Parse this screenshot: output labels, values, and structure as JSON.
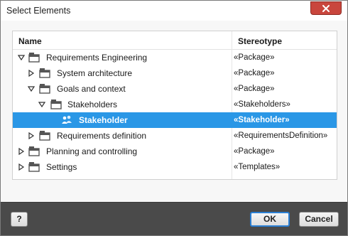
{
  "window": {
    "title": "Select Elements"
  },
  "table": {
    "columns": {
      "name": "Name",
      "stereotype": "Stereotype"
    },
    "rows": [
      {
        "label": "Requirements Engineering",
        "stereotype": "«Package»",
        "expanded": true,
        "icon": "package-icon",
        "selected": false
      },
      {
        "label": "System architecture",
        "stereotype": "«Package»",
        "expanded": false,
        "icon": "package-icon",
        "selected": false
      },
      {
        "label": "Goals and context",
        "stereotype": "«Package»",
        "expanded": true,
        "icon": "package-icon",
        "selected": false
      },
      {
        "label": "Stakeholders",
        "stereotype": "«Stakeholders»",
        "expanded": true,
        "icon": "package-icon",
        "selected": false
      },
      {
        "label": "Stakeholder",
        "stereotype": "«Stakeholder»",
        "expanded": null,
        "icon": "stakeholder-icon",
        "selected": true
      },
      {
        "label": "Requirements definition",
        "stereotype": "«RequirementsDefinition»",
        "expanded": false,
        "icon": "package-icon",
        "selected": false
      },
      {
        "label": "Planning and controlling",
        "stereotype": "«Package»",
        "expanded": false,
        "icon": "package-icon",
        "selected": false
      },
      {
        "label": "Settings",
        "stereotype": "«Templates»",
        "expanded": false,
        "icon": "package-icon",
        "selected": false
      }
    ]
  },
  "footer": {
    "help_label": "?",
    "ok_label": "OK",
    "cancel_label": "Cancel"
  },
  "colors": {
    "selection": "#2a97e6",
    "close_button": "#c9463d",
    "footer_bg": "#4a4a4a",
    "ok_border": "#2a7fd4"
  }
}
